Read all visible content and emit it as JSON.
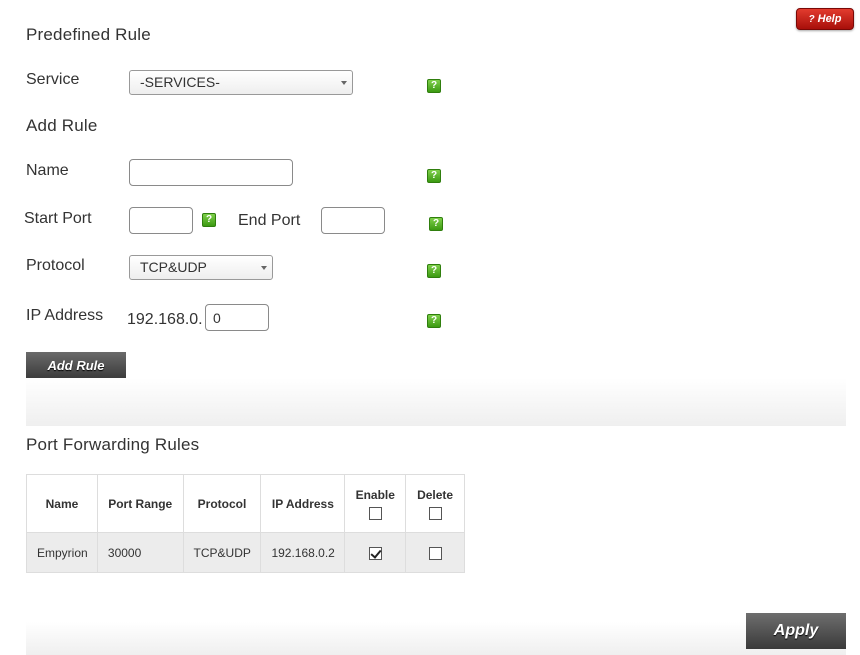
{
  "help": {
    "label": "Help",
    "icon": "question-mark-icon",
    "glyph": "?"
  },
  "predefined": {
    "title": "Predefined Rule",
    "service_label": "Service",
    "service_value": "-SERVICES-"
  },
  "add_rule": {
    "title": "Add Rule",
    "name_label": "Name",
    "name_value": "",
    "start_port_label": "Start Port",
    "start_port_value": "",
    "end_port_label": "End Port",
    "end_port_value": "",
    "protocol_label": "Protocol",
    "protocol_value": "TCP&UDP",
    "ip_label": "IP Address",
    "ip_prefix": "192.168.0.",
    "ip_last_octet": "0",
    "button_label": "Add Rule",
    "hint_glyph": "?"
  },
  "rules": {
    "title": "Port Forwarding Rules",
    "headers": {
      "name": "Name",
      "port_range": "Port Range",
      "protocol": "Protocol",
      "ip_address": "IP Address",
      "enable": "Enable",
      "delete": "Delete"
    },
    "header_enable_checked": false,
    "header_delete_checked": false,
    "rows": [
      {
        "name": "Empyrion",
        "port_range": "30000",
        "protocol": "TCP&UDP",
        "ip_address": "192.168.0.2",
        "enable": true,
        "delete": false
      }
    ]
  },
  "apply_label": "Apply",
  "colors": {
    "help_button": "#c41a12",
    "hint_icon": "#4caf1a",
    "dark_button": "#4a4a4a"
  }
}
